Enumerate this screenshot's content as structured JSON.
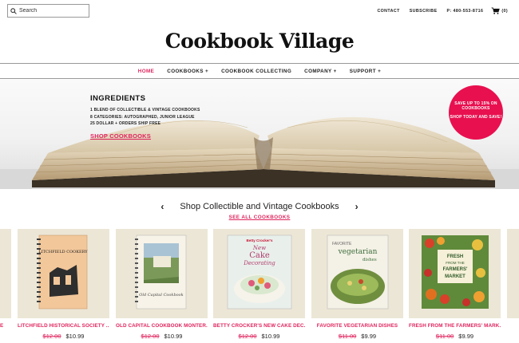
{
  "search": {
    "placeholder": "Search"
  },
  "toplinks": {
    "contact": "CONTACT",
    "subscribe": "SUBSCRIBE",
    "phone": "P: 480-553-8716",
    "cart_count": "(0)"
  },
  "logo": "Cookbook Village",
  "nav": [
    {
      "label": "HOME"
    },
    {
      "label": "COOKBOOKS +"
    },
    {
      "label": "COOKBOOK COLLECTING"
    },
    {
      "label": "COMPANY +"
    },
    {
      "label": "SUPPORT +"
    }
  ],
  "hero": {
    "title": "INGREDIENTS",
    "lines": [
      "1 BLEND OF COLLECTIBLE & VINTAGE COOKBOOKS",
      "8 CATEGORIES: AUTOGRAPHED, JUNIOR LEAGUE",
      "25 DOLLAR + ORDERS SHIP FREE"
    ],
    "link": "SHOP COOKBOOKS",
    "promo_line1": "SAVE UP TO 15% ON COOKBOOKS",
    "promo_line2": "SHOP TODAY AND SAVE!"
  },
  "section": {
    "title": "Shop Collectible and Vintage Cookbooks",
    "see_all": "SEE ALL COOKBOOKS",
    "prev": "‹",
    "next": "›"
  },
  "edge_left_title": "E",
  "products": [
    {
      "title": "LITCHFIELD HISTORICAL SOCIETY ...",
      "old_price": "$12.00",
      "price": "$10.99",
      "cover_title": "LITCHFIELD COOKERY"
    },
    {
      "title": "OLD CAPITAL COOKBOOK MONTER...",
      "old_price": "$12.00",
      "price": "$10.99",
      "cover_title": "Old Capital Cookbook"
    },
    {
      "title": "BETTY CROCKER'S NEW CAKE DEC...",
      "old_price": "$12.00",
      "price": "$10.99",
      "cover_brand": "Betty Crocker's",
      "cover_title_1": "New",
      "cover_title_2": "Cake",
      "cover_title_3": "Decorating"
    },
    {
      "title": "FAVORITE VEGETARIAN DISHES",
      "old_price": "$11.00",
      "price": "$9.99",
      "cover_title_1": "FAVORITE",
      "cover_title_2": "vegetarian",
      "cover_title_3": "dishes"
    },
    {
      "title": "FRESH FROM THE FARMERS' MARK...",
      "old_price": "$11.00",
      "price": "$9.99",
      "cover_title_1": "FRESH",
      "cover_title_2": "FROM THE",
      "cover_title_3": "FARMERS'",
      "cover_title_4": "MARKET"
    }
  ],
  "colors": {
    "accent": "#e0245e",
    "promo": "#e8104f",
    "thumb_bg": "#ece6d6"
  }
}
